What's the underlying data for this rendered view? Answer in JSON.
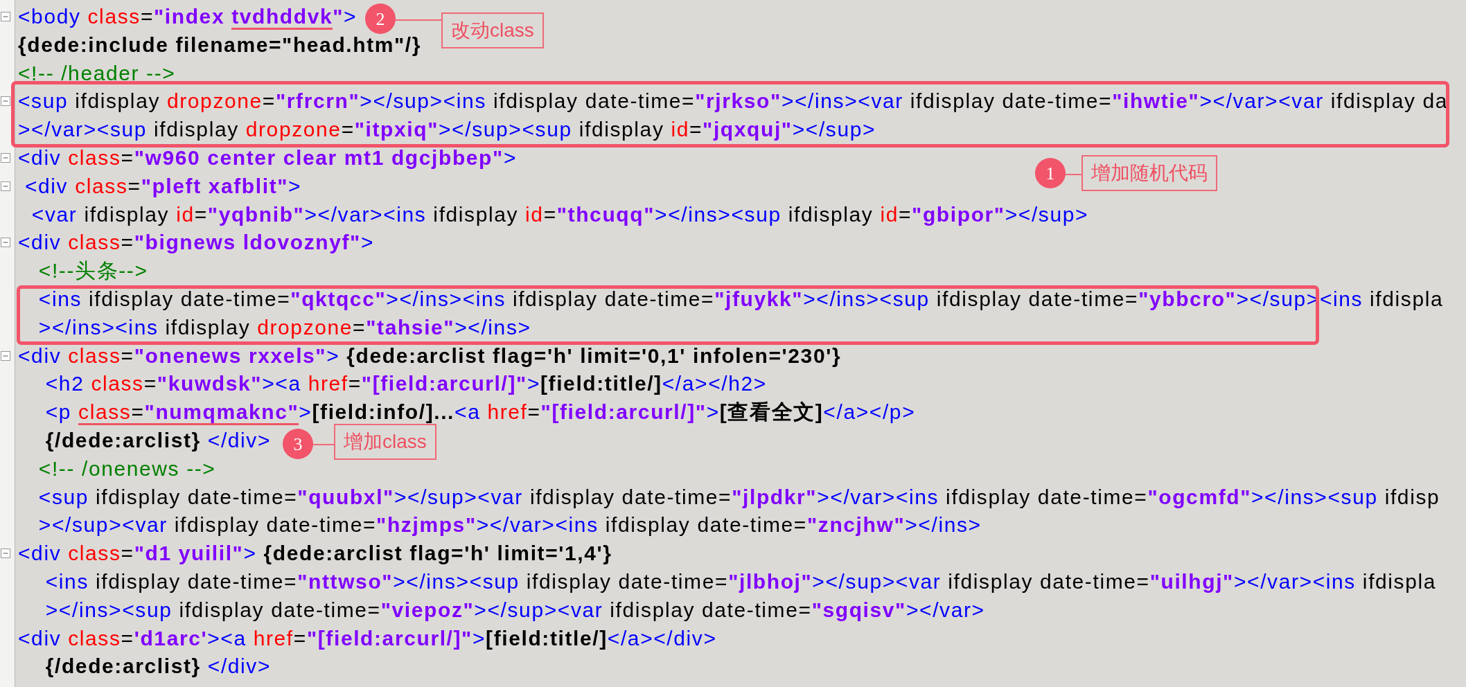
{
  "editor": {
    "lines": [
      {
        "fold": true,
        "boxed": false,
        "tokens": [
          {
            "kind": "tag",
            "text": "<body "
          },
          {
            "kind": "attr",
            "text": "class"
          },
          {
            "kind": "plain",
            "text": "="
          },
          {
            "kind": "value",
            "text": "\"index "
          },
          {
            "kind": "value",
            "text": "tvdhddvk",
            "underlined": true
          },
          {
            "kind": "value",
            "text": "\""
          },
          {
            "kind": "tag",
            "text": ">"
          }
        ]
      },
      {
        "fold": false,
        "boxed": false,
        "tokens": [
          {
            "kind": "dede",
            "text": "{dede:include filename=\"head.htm\"/}"
          }
        ]
      },
      {
        "fold": false,
        "boxed": false,
        "tokens": [
          {
            "kind": "comment",
            "text": "<!-- /header -->"
          }
        ]
      },
      {
        "fold": true,
        "boxed": true,
        "tokens": [
          {
            "kind": "tag",
            "text": "<sup"
          },
          {
            "kind": "plain",
            "text": " ifdisplay "
          },
          {
            "kind": "attr",
            "text": "dropzone"
          },
          {
            "kind": "plain",
            "text": "="
          },
          {
            "kind": "value",
            "text": "\"rfrcrn\""
          },
          {
            "kind": "tag",
            "text": "></sup><ins"
          },
          {
            "kind": "plain",
            "text": " ifdisplay date-time="
          },
          {
            "kind": "value",
            "text": "\"rjrkso\""
          },
          {
            "kind": "tag",
            "text": "></ins><var"
          },
          {
            "kind": "plain",
            "text": " ifdisplay date-time="
          },
          {
            "kind": "value",
            "text": "\"ihwtie\""
          },
          {
            "kind": "tag",
            "text": "></var><var"
          },
          {
            "kind": "plain",
            "text": " ifdisplay da"
          }
        ]
      },
      {
        "fold": false,
        "boxed": true,
        "tokens": [
          {
            "kind": "tag",
            "text": "></var><sup"
          },
          {
            "kind": "plain",
            "text": " ifdisplay "
          },
          {
            "kind": "attr",
            "text": "dropzone"
          },
          {
            "kind": "plain",
            "text": "="
          },
          {
            "kind": "value",
            "text": "\"itpxiq\""
          },
          {
            "kind": "tag",
            "text": "></sup><sup"
          },
          {
            "kind": "plain",
            "text": " ifdisplay "
          },
          {
            "kind": "attr",
            "text": "id"
          },
          {
            "kind": "plain",
            "text": "="
          },
          {
            "kind": "value",
            "text": "\"jqxquj\""
          },
          {
            "kind": "tag",
            "text": "></sup>"
          }
        ]
      },
      {
        "fold": true,
        "boxed": false,
        "tokens": [
          {
            "kind": "tag",
            "text": "<div "
          },
          {
            "kind": "attr",
            "text": "class"
          },
          {
            "kind": "plain",
            "text": "="
          },
          {
            "kind": "value",
            "text": "\"w960 center clear mt1 dgcjbbep\""
          },
          {
            "kind": "tag",
            "text": ">"
          }
        ]
      },
      {
        "fold": true,
        "boxed": false,
        "tokens": [
          {
            "kind": "tag",
            "text": " <div "
          },
          {
            "kind": "attr",
            "text": "class"
          },
          {
            "kind": "plain",
            "text": "="
          },
          {
            "kind": "value",
            "text": "\"pleft xafblit\""
          },
          {
            "kind": "tag",
            "text": ">"
          }
        ]
      },
      {
        "fold": false,
        "boxed": false,
        "tokens": [
          {
            "kind": "tag",
            "text": "  <var"
          },
          {
            "kind": "plain",
            "text": " ifdisplay "
          },
          {
            "kind": "attr",
            "text": "id"
          },
          {
            "kind": "plain",
            "text": "="
          },
          {
            "kind": "value",
            "text": "\"yqbnib\""
          },
          {
            "kind": "tag",
            "text": "></var><ins"
          },
          {
            "kind": "plain",
            "text": " ifdisplay "
          },
          {
            "kind": "attr",
            "text": "id"
          },
          {
            "kind": "plain",
            "text": "="
          },
          {
            "kind": "value",
            "text": "\"thcuqq\""
          },
          {
            "kind": "tag",
            "text": "></ins><sup"
          },
          {
            "kind": "plain",
            "text": " ifdisplay "
          },
          {
            "kind": "attr",
            "text": "id"
          },
          {
            "kind": "plain",
            "text": "="
          },
          {
            "kind": "value",
            "text": "\"gbipor\""
          },
          {
            "kind": "tag",
            "text": "></sup>"
          }
        ]
      },
      {
        "fold": true,
        "boxed": false,
        "tokens": [
          {
            "kind": "tag",
            "text": "<div "
          },
          {
            "kind": "attr",
            "text": "class"
          },
          {
            "kind": "plain",
            "text": "="
          },
          {
            "kind": "value",
            "text": "\"bignews ldovoznyf\""
          },
          {
            "kind": "tag",
            "text": ">"
          }
        ]
      },
      {
        "fold": false,
        "boxed": false,
        "tokens": [
          {
            "kind": "comment",
            "text": "   <!--头条-->"
          }
        ]
      },
      {
        "fold": false,
        "boxed": true,
        "tokens": [
          {
            "kind": "tag",
            "text": "   <ins"
          },
          {
            "kind": "plain",
            "text": " ifdisplay date-time="
          },
          {
            "kind": "value",
            "text": "\"qktqcc\""
          },
          {
            "kind": "tag",
            "text": "></ins><ins"
          },
          {
            "kind": "plain",
            "text": " ifdisplay date-time="
          },
          {
            "kind": "value",
            "text": "\"jfuykk\""
          },
          {
            "kind": "tag",
            "text": "></ins><sup"
          },
          {
            "kind": "plain",
            "text": " ifdisplay date-time="
          },
          {
            "kind": "value",
            "text": "\"ybbcro\""
          },
          {
            "kind": "tag",
            "text": "></sup><ins"
          },
          {
            "kind": "plain",
            "text": " ifdispla"
          }
        ]
      },
      {
        "fold": false,
        "boxed": true,
        "tokens": [
          {
            "kind": "tag",
            "text": "   ></ins><ins"
          },
          {
            "kind": "plain",
            "text": " ifdisplay "
          },
          {
            "kind": "attr",
            "text": "dropzone"
          },
          {
            "kind": "plain",
            "text": "="
          },
          {
            "kind": "value",
            "text": "\"tahsie\""
          },
          {
            "kind": "tag",
            "text": "></ins>"
          }
        ]
      },
      {
        "fold": true,
        "boxed": false,
        "tokens": [
          {
            "kind": "tag",
            "text": "<div "
          },
          {
            "kind": "attr",
            "text": "class"
          },
          {
            "kind": "plain",
            "text": "="
          },
          {
            "kind": "value",
            "text": "\"onenews rxxels\""
          },
          {
            "kind": "tag",
            "text": ">"
          },
          {
            "kind": "dede",
            "text": " {dede:arclist flag='h' limit='0,1' infolen='230'}"
          }
        ]
      },
      {
        "fold": false,
        "boxed": false,
        "tokens": [
          {
            "kind": "tag",
            "text": "    <h2 "
          },
          {
            "kind": "attr",
            "text": "class"
          },
          {
            "kind": "plain",
            "text": "="
          },
          {
            "kind": "value",
            "text": "\"kuwdsk\""
          },
          {
            "kind": "tag",
            "text": "><a "
          },
          {
            "kind": "attr",
            "text": "href"
          },
          {
            "kind": "plain",
            "text": "="
          },
          {
            "kind": "value",
            "text": "\"[field:arcurl/]\""
          },
          {
            "kind": "tag",
            "text": ">"
          },
          {
            "kind": "dede",
            "text": "[field:title/]"
          },
          {
            "kind": "tag",
            "text": "</a></h2>"
          }
        ]
      },
      {
        "fold": false,
        "boxed": false,
        "tokens": [
          {
            "kind": "tag",
            "text": "    <p "
          },
          {
            "kind": "attr",
            "text": "class",
            "underlined": true
          },
          {
            "kind": "plain",
            "text": "=",
            "underlined": true
          },
          {
            "kind": "value",
            "text": "\"numqmaknc\"",
            "underlined": true
          },
          {
            "kind": "tag",
            "text": ">"
          },
          {
            "kind": "dede",
            "text": "[field:info/]..."
          },
          {
            "kind": "tag",
            "text": "<a "
          },
          {
            "kind": "attr",
            "text": "href"
          },
          {
            "kind": "plain",
            "text": "="
          },
          {
            "kind": "value",
            "text": "\"[field:arcurl/]\""
          },
          {
            "kind": "tag",
            "text": ">"
          },
          {
            "kind": "dede",
            "text": "[查看全文]"
          },
          {
            "kind": "tag",
            "text": "</a></p>"
          }
        ]
      },
      {
        "fold": false,
        "boxed": false,
        "tokens": [
          {
            "kind": "dede",
            "text": "    {/dede:arclist}"
          },
          {
            "kind": "tag",
            "text": " </div>"
          }
        ]
      },
      {
        "fold": false,
        "boxed": false,
        "tokens": [
          {
            "kind": "comment",
            "text": "   <!-- /onenews -->"
          }
        ]
      },
      {
        "fold": false,
        "boxed": false,
        "tokens": [
          {
            "kind": "tag",
            "text": "   <sup"
          },
          {
            "kind": "plain",
            "text": " ifdisplay date-time="
          },
          {
            "kind": "value",
            "text": "\"quubxl\""
          },
          {
            "kind": "tag",
            "text": "></sup><var"
          },
          {
            "kind": "plain",
            "text": " ifdisplay date-time="
          },
          {
            "kind": "value",
            "text": "\"jlpdkr\""
          },
          {
            "kind": "tag",
            "text": "></var><ins"
          },
          {
            "kind": "plain",
            "text": " ifdisplay date-time="
          },
          {
            "kind": "value",
            "text": "\"ogcmfd\""
          },
          {
            "kind": "tag",
            "text": "></ins><sup"
          },
          {
            "kind": "plain",
            "text": " ifdisp"
          }
        ]
      },
      {
        "fold": false,
        "boxed": false,
        "tokens": [
          {
            "kind": "tag",
            "text": "   ></sup><var"
          },
          {
            "kind": "plain",
            "text": " ifdisplay date-time="
          },
          {
            "kind": "value",
            "text": "\"hzjmps\""
          },
          {
            "kind": "tag",
            "text": "></var><ins"
          },
          {
            "kind": "plain",
            "text": " ifdisplay date-time="
          },
          {
            "kind": "value",
            "text": "\"zncjhw\""
          },
          {
            "kind": "tag",
            "text": "></ins>"
          }
        ]
      },
      {
        "fold": true,
        "boxed": false,
        "tokens": [
          {
            "kind": "tag",
            "text": "<div "
          },
          {
            "kind": "attr",
            "text": "class"
          },
          {
            "kind": "plain",
            "text": "="
          },
          {
            "kind": "value",
            "text": "\"d1 yuilil\""
          },
          {
            "kind": "tag",
            "text": ">"
          },
          {
            "kind": "dede",
            "text": " {dede:arclist flag='h' limit='1,4'}"
          }
        ]
      },
      {
        "fold": false,
        "boxed": false,
        "tokens": [
          {
            "kind": "tag",
            "text": "    <ins"
          },
          {
            "kind": "plain",
            "text": " ifdisplay date-time="
          },
          {
            "kind": "value",
            "text": "\"nttwso\""
          },
          {
            "kind": "tag",
            "text": "></ins><sup"
          },
          {
            "kind": "plain",
            "text": " ifdisplay date-time="
          },
          {
            "kind": "value",
            "text": "\"jlbhoj\""
          },
          {
            "kind": "tag",
            "text": "></sup><var"
          },
          {
            "kind": "plain",
            "text": " ifdisplay date-time="
          },
          {
            "kind": "value",
            "text": "\"uilhgj\""
          },
          {
            "kind": "tag",
            "text": "></var><ins"
          },
          {
            "kind": "plain",
            "text": " ifdispla"
          }
        ]
      },
      {
        "fold": false,
        "boxed": false,
        "tokens": [
          {
            "kind": "tag",
            "text": "    ></ins><sup"
          },
          {
            "kind": "plain",
            "text": " ifdisplay date-time="
          },
          {
            "kind": "value",
            "text": "\"viepoz\""
          },
          {
            "kind": "tag",
            "text": "></sup><var"
          },
          {
            "kind": "plain",
            "text": " ifdisplay date-time="
          },
          {
            "kind": "value",
            "text": "\"sgqisv\""
          },
          {
            "kind": "tag",
            "text": "></var>"
          }
        ]
      },
      {
        "fold": false,
        "boxed": false,
        "tokens": [
          {
            "kind": "tag",
            "text": "<div "
          },
          {
            "kind": "attr",
            "text": "class"
          },
          {
            "kind": "plain",
            "text": "="
          },
          {
            "kind": "value",
            "text": "'d1arc'"
          },
          {
            "kind": "tag",
            "text": "><a "
          },
          {
            "kind": "attr",
            "text": "href"
          },
          {
            "kind": "plain",
            "text": "="
          },
          {
            "kind": "value",
            "text": "\"[field:arcurl/]\""
          },
          {
            "kind": "tag",
            "text": ">"
          },
          {
            "kind": "dede",
            "text": "[field:title/]"
          },
          {
            "kind": "tag",
            "text": "</a></div>"
          }
        ]
      },
      {
        "fold": false,
        "boxed": false,
        "tokens": [
          {
            "kind": "dede",
            "text": "    {/dede:arclist}"
          },
          {
            "kind": "tag",
            "text": " </div>"
          }
        ]
      }
    ]
  },
  "callouts": [
    {
      "number": "2",
      "label": "改动class"
    },
    {
      "number": "1",
      "label": "增加随机代码"
    },
    {
      "number": "3",
      "label": "增加class"
    }
  ]
}
